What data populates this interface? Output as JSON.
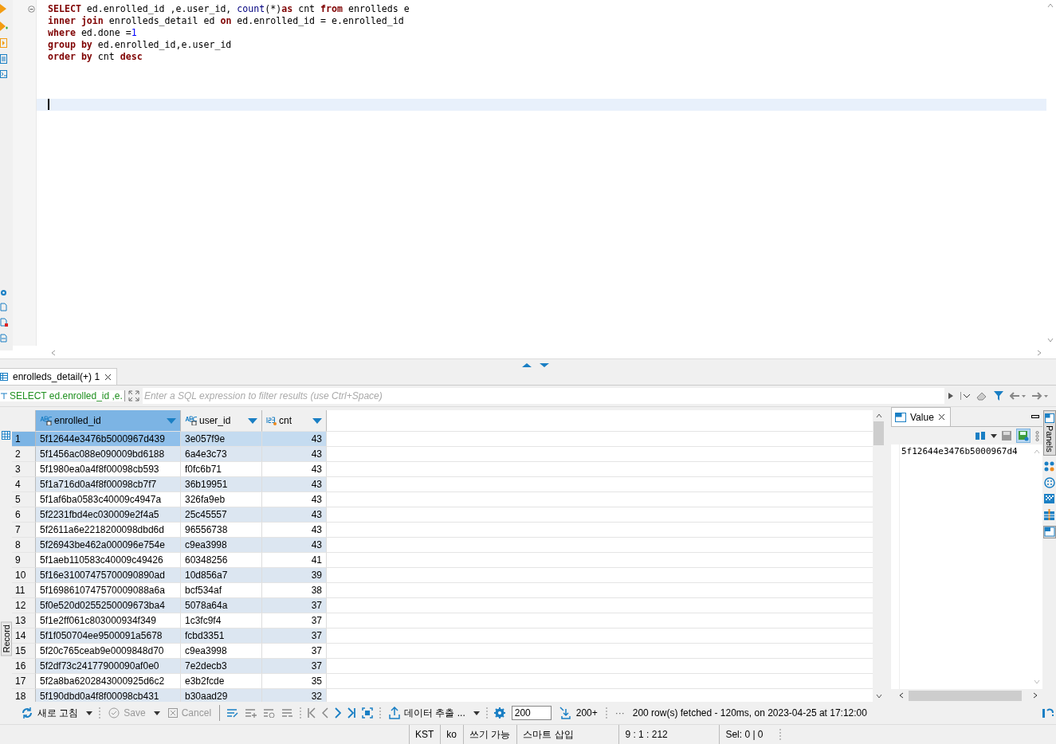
{
  "editor": {
    "lines": [
      [
        {
          "text": "SELECT",
          "kind": "keyword"
        },
        {
          "text": " ed.enrolled_id ,e.user_id, ",
          "kind": "plain"
        },
        {
          "text": "count",
          "kind": "function"
        },
        {
          "text": "(*)",
          "kind": "plain"
        },
        {
          "text": "as",
          "kind": "keyword"
        },
        {
          "text": " cnt ",
          "kind": "plain"
        },
        {
          "text": "from",
          "kind": "keyword"
        },
        {
          "text": " enrolleds e",
          "kind": "plain"
        }
      ],
      [
        {
          "text": "inner join",
          "kind": "keyword"
        },
        {
          "text": " enrolleds_detail ed ",
          "kind": "plain"
        },
        {
          "text": "on",
          "kind": "keyword"
        },
        {
          "text": " ed.enrolled_id = e.enrolled_id",
          "kind": "plain"
        }
      ],
      [
        {
          "text": "where",
          "kind": "keyword"
        },
        {
          "text": " ed.done =",
          "kind": "plain"
        },
        {
          "text": "1",
          "kind": "number"
        }
      ],
      [
        {
          "text": "group by",
          "kind": "keyword"
        },
        {
          "text": " ed.enrolled_id,e.user_id",
          "kind": "plain"
        }
      ],
      [
        {
          "text": "order by",
          "kind": "keyword"
        },
        {
          "text": " cnt ",
          "kind": "plain"
        },
        {
          "text": "desc",
          "kind": "keyword"
        }
      ]
    ],
    "current_line_highlight": true
  },
  "result_tabs": [
    {
      "label": "enrolleds_detail(+) 1",
      "selected": true
    }
  ],
  "filter": {
    "query": "SELECT ed.enrolled_id ,e.",
    "placeholder": "Enter a SQL expression to filter results (use Ctrl+Space)"
  },
  "left_panel_label": "Record",
  "grid": {
    "columns": [
      {
        "name": "enrolled_id",
        "kind": "text",
        "selected": true
      },
      {
        "name": "user_id",
        "kind": "text",
        "selected": false
      },
      {
        "name": "cnt",
        "kind": "number",
        "selected": false
      }
    ],
    "rows": [
      {
        "number": "1",
        "cells": [
          "5f12644e3476b5000967d439",
          "3e057f9e",
          "43"
        ],
        "selected": true
      },
      {
        "number": "2",
        "cells": [
          "5f1456ac088e090009bd6188",
          "6a4e3c73",
          "43"
        ],
        "selected": false
      },
      {
        "number": "3",
        "cells": [
          "5f1980ea0a4f8f00098cb593",
          "f0fc6b71",
          "43"
        ],
        "selected": false
      },
      {
        "number": "4",
        "cells": [
          "5f1a716d0a4f8f00098cb7f7",
          "36b19951",
          "43"
        ],
        "selected": false
      },
      {
        "number": "5",
        "cells": [
          "5f1af6ba0583c40009c4947a",
          "326fa9eb",
          "43"
        ],
        "selected": false
      },
      {
        "number": "6",
        "cells": [
          "5f2231fbd4ec030009e2f4a5",
          "25c45557",
          "43"
        ],
        "selected": false
      },
      {
        "number": "7",
        "cells": [
          "5f2611a6e2218200098dbd6d",
          "96556738",
          "43"
        ],
        "selected": false
      },
      {
        "number": "8",
        "cells": [
          "5f26943be462a000096e754e",
          "c9ea3998",
          "43"
        ],
        "selected": false
      },
      {
        "number": "9",
        "cells": [
          "5f1aeb110583c40009c49426",
          "60348256",
          "41"
        ],
        "selected": false
      },
      {
        "number": "10",
        "cells": [
          "5f16e31007475700090890ad",
          "10d856a7",
          "39"
        ],
        "selected": false
      },
      {
        "number": "11",
        "cells": [
          "5f1698610747570009088a6a",
          "bcf534af",
          "38"
        ],
        "selected": false
      },
      {
        "number": "12",
        "cells": [
          "5f0e520d0255250009673ba4",
          "5078a64a",
          "37"
        ],
        "selected": false
      },
      {
        "number": "13",
        "cells": [
          "5f1e2ff061c803000934f349",
          "1c3fc9f4",
          "37"
        ],
        "selected": false
      },
      {
        "number": "14",
        "cells": [
          "5f1f050704ee9500091a5678",
          "fcbd3351",
          "37"
        ],
        "selected": false
      },
      {
        "number": "15",
        "cells": [
          "5f20c765ceab9e0009848d70",
          "c9ea3998",
          "37"
        ],
        "selected": false
      },
      {
        "number": "16",
        "cells": [
          "5f2df73c24177900090af0e0",
          "7e2decb3",
          "37"
        ],
        "selected": false
      },
      {
        "number": "17",
        "cells": [
          "5f2a8ba6202843000925d6c2",
          "e3b2fcde",
          "35"
        ],
        "selected": false
      },
      {
        "number": "18",
        "cells": [
          "5f190dbd0a4f8f00098cb431",
          "b30aad29",
          "32"
        ],
        "selected": false
      }
    ]
  },
  "value_panel": {
    "title": "Value",
    "content": "5f12644e3476b5000967d4"
  },
  "side_panel_label": "Panels",
  "toolbar": {
    "refresh": {
      "label": "새로 고침",
      "disabled": false
    },
    "save": {
      "label": "Save",
      "disabled": true
    },
    "cancel": {
      "label": "Cancel",
      "disabled": true
    },
    "export": {
      "label": "데이터 추출 ..."
    },
    "fetch_size": "200",
    "fetch_more": "200+",
    "more": "···",
    "status": "200 row(s) fetched - 120ms, on 2023-04-25 at 17:12:00"
  },
  "status_bar": [
    "KST",
    "ko",
    "쓰기 가능",
    "스마트 삽입",
    "9 : 1 : 212",
    "Sel: 0 | 0"
  ]
}
